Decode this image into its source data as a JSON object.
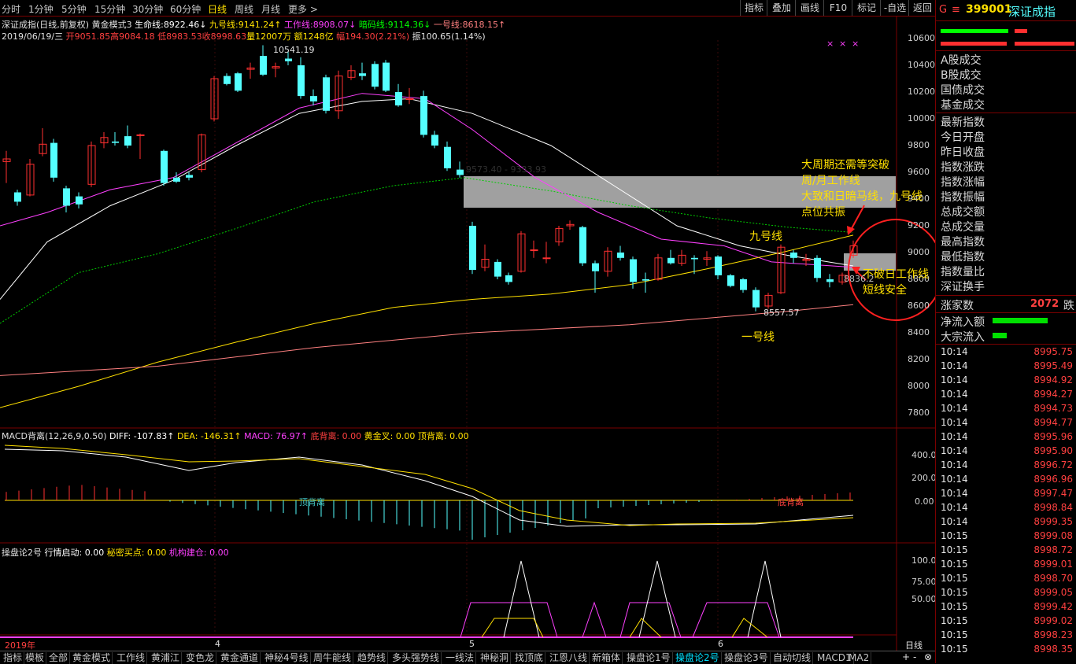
{
  "timeframe_tabs": [
    "分时",
    "1分钟",
    "5分钟",
    "15分钟",
    "30分钟",
    "60分钟",
    "日线",
    "周线",
    "月线",
    "更多 >"
  ],
  "active_timeframe": "日线",
  "toolbar_right": [
    "指标",
    "叠加",
    "画线",
    "F10",
    "标记",
    "-自选",
    "返回"
  ],
  "header": {
    "title": "深证成指(日线,前复权)",
    "mode": "黄金模式3",
    "lines": [
      {
        "label": "生命线:",
        "value": "8922.46↓",
        "color": "#ffffff"
      },
      {
        "label": "九号线:",
        "value": "9141.24↑",
        "color": "#ffe000"
      },
      {
        "label": "工作线:",
        "value": "8908.07↓",
        "color": "#ff40ff"
      },
      {
        "label": "暗码线:",
        "value": "9114.36↓",
        "color": "#00ff00"
      },
      {
        "label": "一号线:",
        "value": "8618.15↑",
        "color": "#ff8080"
      }
    ],
    "ohlc_line": {
      "date": "2019/06/19/三",
      "open": "开9051.85",
      "high": "高9084.18",
      "low": "低8983.53",
      "close": "收8998.63",
      "volume": "量12007万",
      "amount": "额1248亿",
      "change": "幅194.30(2.21%)",
      "amplitude": "振100.65(1.14%)"
    }
  },
  "price_axis": [
    "10600",
    "10400",
    "10200",
    "10000",
    "9800",
    "9600",
    "9400",
    "9200",
    "9000",
    "8800",
    "8600",
    "8400",
    "8200",
    "8000",
    "7800"
  ],
  "price_annotations": {
    "high_label": "10541.19",
    "low_label": "8557.57",
    "box_label": "9573.40 - 9333.93",
    "last_label": "8836.2"
  },
  "line_labels": {
    "nine": "九号线",
    "one": "一号线"
  },
  "annotations": {
    "line1": "大周期还需等突破",
    "line2": "周/月工作线",
    "line3": "大致和日暗马线，九号线",
    "line4": "点位共振",
    "note1": "不破日工作线",
    "note2": "短线安全"
  },
  "macd": {
    "title": "MACD背离(12,26,9,0.50)",
    "diff": "DIFF: -107.83↑",
    "dea": "DEA: -146.31↑",
    "macd": "MACD: 76.97↑",
    "bottom_div": "底背离: 0.00",
    "golden": "黄金叉: 0.00",
    "top_div": "顶背离: 0.00",
    "axis": [
      "400.0",
      "200.0",
      "0.00"
    ],
    "label_top": "顶背离",
    "label_bottom": "底背离"
  },
  "op": {
    "title": "操盘论2号",
    "start": "行情启动: 0.00",
    "secret": "秘密买点: 0.00",
    "inst": "机构建仓: 0.00",
    "axis": [
      "100.0",
      "75.00",
      "50.00"
    ]
  },
  "date_axis": [
    "2019年",
    "4",
    "5",
    "6"
  ],
  "bottom_tabs": [
    "指标",
    "模板",
    "全部",
    "黄金模式",
    "工作线",
    "黄浦江",
    "变色龙",
    "黄金通道",
    "神秘4号线",
    "周牛能线",
    "趋势线",
    "多头强势线",
    "一线法",
    "神秘洞",
    "找顶底",
    "江恩八线",
    "新箱体",
    "操盘论1号",
    "操盘论2号",
    "操盘论3号",
    "自动切线",
    "MACD1",
    "MA2"
  ],
  "active_bottom_tab": "操盘论2号",
  "bottom_right": {
    "period": "日线",
    "plus": "+",
    "minus": "-",
    "icon": "⊗"
  },
  "right_panel": {
    "code_prefix": "G",
    "menu_icon": "≡",
    "code": "399001",
    "name": "深证成指",
    "items_a": [
      "A股成交",
      "B股成交",
      "国债成交",
      "基金成交"
    ],
    "items_b": [
      "最新指数",
      "今日开盘",
      "昨日收盘",
      "指数涨跌",
      "指数涨幅",
      "指数振幅",
      "总成交额",
      "总成交量",
      "最高指数",
      "最低指数",
      "指数量比",
      "深证换手"
    ],
    "rise_label": "涨家数",
    "rise_value": "2072",
    "fall_label": "跌",
    "net_flow_label": "净流入额",
    "block_flow_label": "大宗流入",
    "ticks": [
      {
        "t": "10:14",
        "p": "8995.75"
      },
      {
        "t": "10:14",
        "p": "8995.49"
      },
      {
        "t": "10:14",
        "p": "8994.92"
      },
      {
        "t": "10:14",
        "p": "8994.27"
      },
      {
        "t": "10:14",
        "p": "8994.73"
      },
      {
        "t": "10:14",
        "p": "8994.77"
      },
      {
        "t": "10:14",
        "p": "8995.96"
      },
      {
        "t": "10:14",
        "p": "8995.90"
      },
      {
        "t": "10:14",
        "p": "8996.72"
      },
      {
        "t": "10:14",
        "p": "8996.96"
      },
      {
        "t": "10:14",
        "p": "8997.47"
      },
      {
        "t": "10:14",
        "p": "8998.84"
      },
      {
        "t": "10:14",
        "p": "8999.35"
      },
      {
        "t": "10:15",
        "p": "8999.08"
      },
      {
        "t": "10:15",
        "p": "8998.72"
      },
      {
        "t": "10:15",
        "p": "8999.01"
      },
      {
        "t": "10:15",
        "p": "8998.70"
      },
      {
        "t": "10:15",
        "p": "8999.05"
      },
      {
        "t": "10:15",
        "p": "8999.42"
      },
      {
        "t": "10:15",
        "p": "8999.02"
      },
      {
        "t": "10:15",
        "p": "8998.23"
      },
      {
        "t": "10:15",
        "p": "8998.35"
      }
    ]
  },
  "colors": {
    "up": "#ff3030",
    "down": "#54ffff",
    "bg": "#000000",
    "border": "#7a0000"
  }
}
